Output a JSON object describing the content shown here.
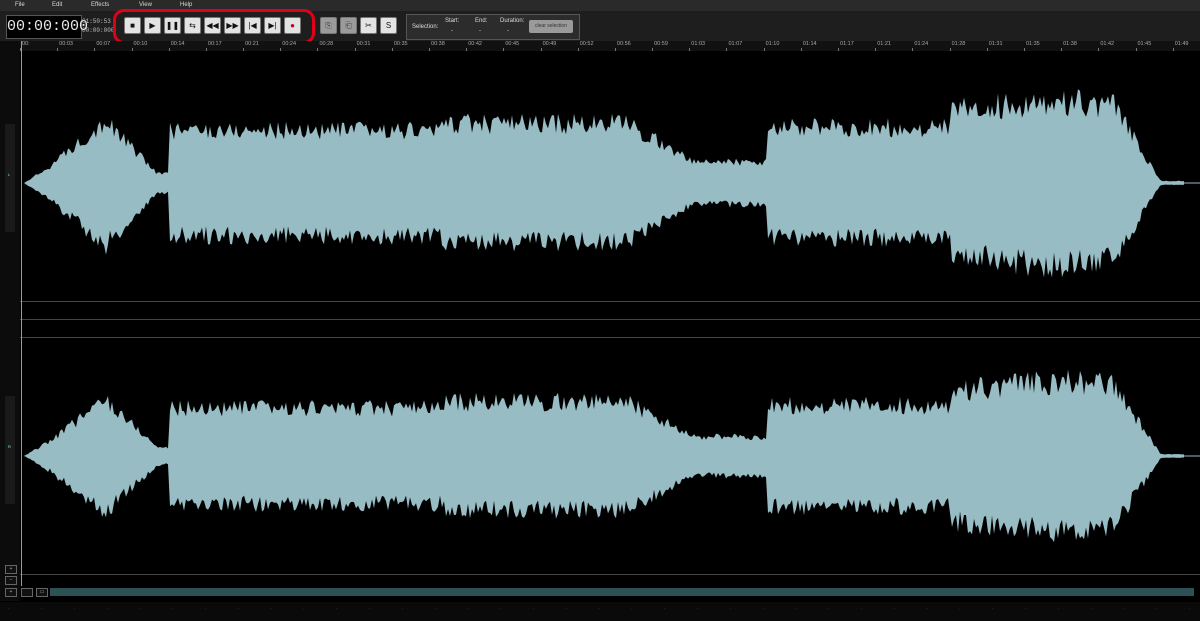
{
  "menu": [
    "File",
    "Edit",
    "Effects",
    "View",
    "Help"
  ],
  "time_display": "00:00:000",
  "duration_total": "01:50:53",
  "duration_current": "00:00:000",
  "transport": [
    {
      "name": "stop-icon",
      "glyph": "■"
    },
    {
      "name": "play-icon",
      "glyph": "▶"
    },
    {
      "name": "pause-icon",
      "glyph": "❚❚"
    },
    {
      "name": "loop-icon",
      "glyph": "⇆"
    },
    {
      "name": "rewind-icon",
      "glyph": "◀◀"
    },
    {
      "name": "fast-forward-icon",
      "glyph": "▶▶"
    },
    {
      "name": "skip-start-icon",
      "glyph": "|◀"
    },
    {
      "name": "skip-end-icon",
      "glyph": "▶|"
    },
    {
      "name": "record-icon",
      "glyph": "●"
    }
  ],
  "edit_tools": [
    {
      "name": "copy-icon",
      "glyph": "⎘"
    },
    {
      "name": "paste-icon",
      "glyph": "⎗"
    },
    {
      "name": "cut-icon",
      "glyph": "✂"
    },
    {
      "name": "silence-icon",
      "glyph": "S"
    }
  ],
  "selection": {
    "label": "Selection:",
    "start_label": "Start:",
    "start_value": "-",
    "end_label": "End:",
    "end_value": "-",
    "duration_label": "Duration:",
    "duration_value": "-",
    "clear_label": "clear selection"
  },
  "timeline_ticks": [
    "00:",
    "00:03",
    "00:07",
    "00:10",
    "00:14",
    "00:17",
    "00:21",
    "00:24",
    "00:28",
    "00:31",
    "00:35",
    "00:38",
    "00:42",
    "00:45",
    "00:49",
    "00:52",
    "00:56",
    "00:59",
    "01:03",
    "01:07",
    "01:10",
    "01:14",
    "01:17",
    "01:21",
    "01:24",
    "01:28",
    "01:31",
    "01:35",
    "01:38",
    "01:42",
    "01:45",
    "01:49"
  ],
  "channels": [
    {
      "label": "L"
    },
    {
      "label": "R"
    }
  ],
  "colors": {
    "waveform": "#97bcc3",
    "highlight": "#e0001a",
    "cursor": "#c9a400",
    "scrollbar": "#2e5156"
  }
}
